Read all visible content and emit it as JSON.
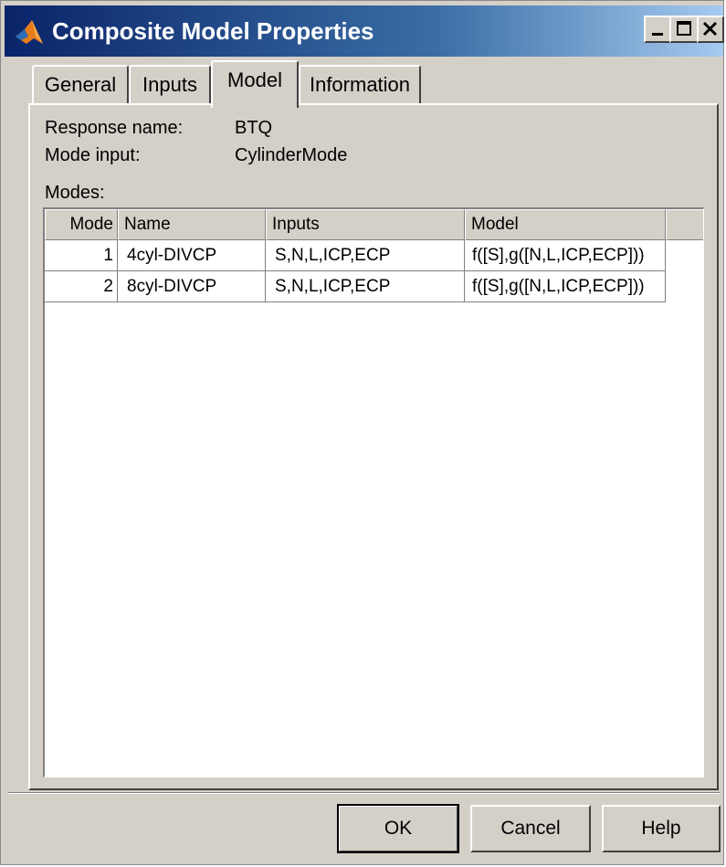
{
  "window": {
    "title": "Composite Model Properties",
    "controls": {
      "minimize": "minimize",
      "maximize": "maximize",
      "close": "close"
    }
  },
  "tabs": [
    {
      "label": "General",
      "active": false
    },
    {
      "label": "Inputs",
      "active": false
    },
    {
      "label": "Model",
      "active": true
    },
    {
      "label": "Information",
      "active": false
    }
  ],
  "model": {
    "response_label": "Response name:",
    "response_value": "BTQ",
    "mode_input_label": "Mode input:",
    "mode_input_value": "CylinderMode",
    "modes_label": "Modes:"
  },
  "table": {
    "columns": [
      "Mode",
      "Name",
      "Inputs",
      "Model"
    ],
    "rows": [
      {
        "mode": "1",
        "name": "4cyl-DIVCP",
        "inputs": "S,N,L,ICP,ECP",
        "model": "f([S],g([N,L,ICP,ECP]))"
      },
      {
        "mode": "2",
        "name": "8cyl-DIVCP",
        "inputs": "S,N,L,ICP,ECP",
        "model": "f([S],g([N,L,ICP,ECP]))"
      }
    ]
  },
  "buttons": {
    "ok": "OK",
    "cancel": "Cancel",
    "help": "Help"
  },
  "colors": {
    "titlebar_start": "#0a246a",
    "titlebar_end": "#a6caf0",
    "face": "#d4d0c8"
  },
  "icons": {
    "app": "matlab-icon"
  }
}
